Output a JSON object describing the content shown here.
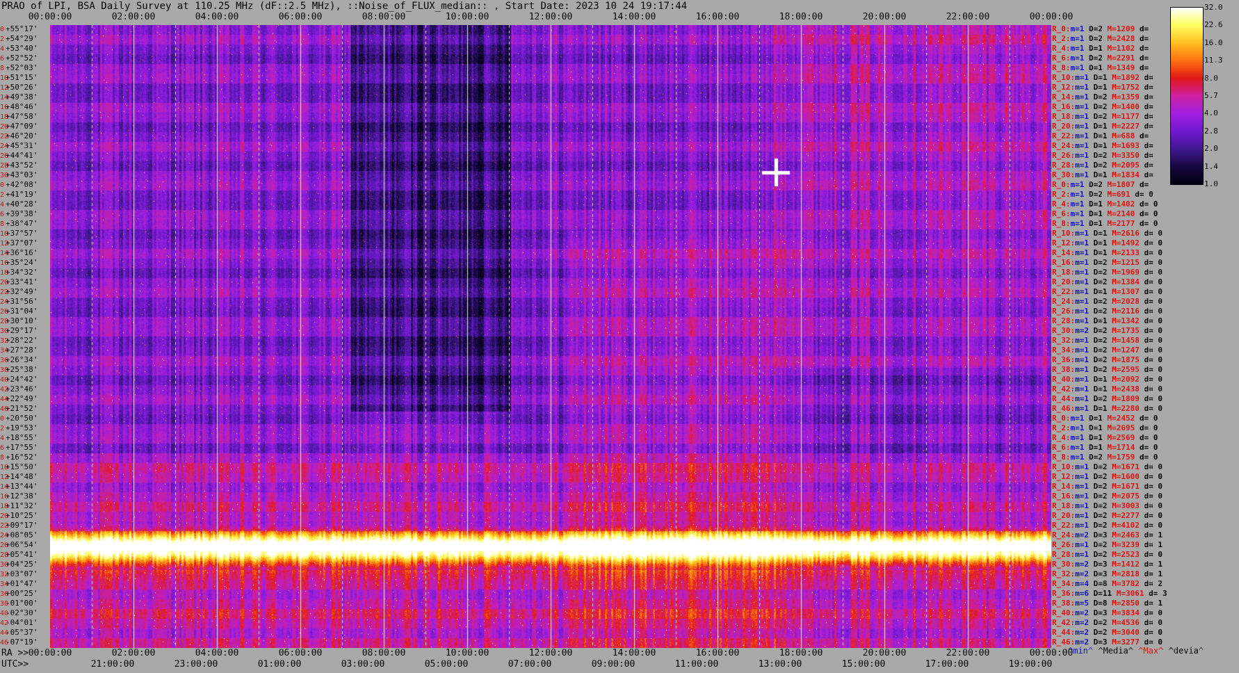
{
  "title": "PRAO of LPI, BSA Daily Survey at 110.25 MHz (dF::2.5 MHz), ::Noise_of_FLUX_median:: , Start Date: 2023 10 24 19:17:44",
  "chart_data": {
    "type": "heatmap",
    "title": "PRAO of LPI, BSA Daily Survey at 110.25 MHz (dF::2.5 MHz), ::Noise_of_FLUX_median:: , Start Date: 2023 10 24 19:17:44",
    "top_ticks": [
      "00:00:00",
      "02:00:00",
      "04:00:00",
      "06:00:00",
      "08:00:00",
      "10:00:00",
      "12:00:00",
      "14:00:00",
      "16:00:00",
      "18:00:00",
      "20:00:00",
      "22:00:00",
      "00:00:00"
    ],
    "bottom_ra_prefix": "RA >>",
    "bottom_ra_ticks": [
      "00:00:00",
      "02:00:00",
      "04:00:00",
      "06:00:00",
      "08:00:00",
      "10:00:00",
      "12:00:00",
      "14:00:00",
      "16:00:00",
      "18:00:00",
      "20:00:00",
      "22:00:00",
      "00:00:00"
    ],
    "bottom_utc_prefix": "UTC>>",
    "bottom_utc_ticks": [
      "21:00:00",
      "23:00:00",
      "01:00:00",
      "03:00:00",
      "05:00:00",
      "07:00:00",
      "09:00:00",
      "11:00:00",
      "13:00:00",
      "15:00:00",
      "17:00:00",
      "19:00:00"
    ],
    "colorbar_ticks": [
      "32.0",
      "22.6",
      "16.0",
      "11.3",
      "8.0",
      "5.7",
      "4.0",
      "2.8",
      "2.0",
      "1.4",
      "1.0"
    ],
    "colorbar_colors": [
      "#ffffff",
      "#ffff60",
      "#ffc020",
      "#ff7010",
      "#e01818",
      "#d020a0",
      "#a020e0",
      "#7018d0",
      "#401890",
      "#180840",
      "#000010"
    ],
    "rows": [
      {
        "i": "0",
        "dec": "+55°17'",
        "r": "R_0:",
        "m": "1",
        "D": "2",
        "M": "1209",
        "tail": "d="
      },
      {
        "i": "2",
        "dec": "+54°29'",
        "r": "R_2:",
        "m": "1",
        "D": "2",
        "M": "2428",
        "tail": "d="
      },
      {
        "i": "4",
        "dec": "+53°40'",
        "r": "R_4:",
        "m": "1",
        "D": "1",
        "M": "1102",
        "tail": "d="
      },
      {
        "i": "6",
        "dec": "+52°52'",
        "r": "R_6:",
        "m": "1",
        "D": "2",
        "M": "2291",
        "tail": "d="
      },
      {
        "i": "8",
        "dec": "+52°03'",
        "r": "R_8:",
        "m": "1",
        "D": "1",
        "M": "1349",
        "tail": "d="
      },
      {
        "i": "10",
        "dec": "+51°15'",
        "r": "R_10:",
        "m": "1",
        "D": "1",
        "M": "1892",
        "tail": "d="
      },
      {
        "i": "12",
        "dec": "+50°26'",
        "r": "R_12:",
        "m": "1",
        "D": "1",
        "M": "1752",
        "tail": "d="
      },
      {
        "i": "14",
        "dec": "+49°38'",
        "r": "R_14:",
        "m": "1",
        "D": "2",
        "M": "1359",
        "tail": "d="
      },
      {
        "i": "16",
        "dec": "+48°46'",
        "r": "R_16:",
        "m": "1",
        "D": "2",
        "M": "1400",
        "tail": "d="
      },
      {
        "i": "18",
        "dec": "+47°58'",
        "r": "R_18:",
        "m": "1",
        "D": "2",
        "M": "1177",
        "tail": "d="
      },
      {
        "i": "20",
        "dec": "+47°09'",
        "r": "R_20:",
        "m": "1",
        "D": "1",
        "M": "2227",
        "tail": "d="
      },
      {
        "i": "22",
        "dec": "+46°20'",
        "r": "R_22:",
        "m": "1",
        "D": "1",
        "M": "688",
        "tail": "d="
      },
      {
        "i": "24",
        "dec": "+45°31'",
        "r": "R_24:",
        "m": "1",
        "D": "1",
        "M": "1693",
        "tail": "d="
      },
      {
        "i": "26",
        "dec": "+44°41'",
        "r": "R_26:",
        "m": "1",
        "D": "2",
        "M": "3350",
        "tail": "d="
      },
      {
        "i": "28",
        "dec": "+43°52'",
        "r": "R_28:",
        "m": "1",
        "D": "2",
        "M": "2095",
        "tail": "d="
      },
      {
        "i": "30",
        "dec": "+43°03'",
        "r": "R_30:",
        "m": "1",
        "D": "1",
        "M": "1834",
        "tail": "d="
      },
      {
        "i": "0",
        "dec": "+42°08'",
        "r": "R_0:",
        "m": "1",
        "D": "2",
        "M": "1807",
        "tail": "d="
      },
      {
        "i": "2",
        "dec": "+41°19'",
        "r": "R_2:",
        "m": "1",
        "D": "2",
        "M": "691",
        "tail": "d= 0"
      },
      {
        "i": "4",
        "dec": "+40°28'",
        "r": "R_4:",
        "m": "1",
        "D": "1",
        "M": "1402",
        "tail": "d= 0"
      },
      {
        "i": "6",
        "dec": "+39°38'",
        "r": "R_6:",
        "m": "1",
        "D": "1",
        "M": "2140",
        "tail": "d= 0"
      },
      {
        "i": "8",
        "dec": "+38°47'",
        "r": "R_8:",
        "m": "1",
        "D": "1",
        "M": "2177",
        "tail": "d= 0"
      },
      {
        "i": "10",
        "dec": "+37°57'",
        "r": "R_10:",
        "m": "1",
        "D": "1",
        "M": "2616",
        "tail": "d= 0"
      },
      {
        "i": "12",
        "dec": "+37°07'",
        "r": "R_12:",
        "m": "1",
        "D": "1",
        "M": "1492",
        "tail": "d= 0"
      },
      {
        "i": "14",
        "dec": "+36°16'",
        "r": "R_14:",
        "m": "1",
        "D": "1",
        "M": "2133",
        "tail": "d= 0"
      },
      {
        "i": "16",
        "dec": "+35°24'",
        "r": "R_16:",
        "m": "1",
        "D": "2",
        "M": "1215",
        "tail": "d= 0"
      },
      {
        "i": "18",
        "dec": "+34°32'",
        "r": "R_18:",
        "m": "1",
        "D": "2",
        "M": "1969",
        "tail": "d= 0"
      },
      {
        "i": "20",
        "dec": "+33°41'",
        "r": "R_20:",
        "m": "1",
        "D": "2",
        "M": "1384",
        "tail": "d= 0"
      },
      {
        "i": "22",
        "dec": "+32°49'",
        "r": "R_22:",
        "m": "1",
        "D": "1",
        "M": "1307",
        "tail": "d= 0"
      },
      {
        "i": "24",
        "dec": "+31°56'",
        "r": "R_24:",
        "m": "1",
        "D": "2",
        "M": "2028",
        "tail": "d= 0"
      },
      {
        "i": "26",
        "dec": "+31°04'",
        "r": "R_26:",
        "m": "1",
        "D": "2",
        "M": "2116",
        "tail": "d= 0"
      },
      {
        "i": "28",
        "dec": "+30°10'",
        "r": "R_28:",
        "m": "1",
        "D": "1",
        "M": "1342",
        "tail": "d= 0"
      },
      {
        "i": "30",
        "dec": "+29°17'",
        "r": "R_30:",
        "m": "2",
        "D": "2",
        "M": "1735",
        "tail": "d= 0"
      },
      {
        "i": "32",
        "dec": "+28°22'",
        "r": "R_32:",
        "m": "1",
        "D": "2",
        "M": "1458",
        "tail": "d= 0"
      },
      {
        "i": "34",
        "dec": "+27°28'",
        "r": "R_34:",
        "m": "1",
        "D": "2",
        "M": "1247",
        "tail": "d= 0"
      },
      {
        "i": "36",
        "dec": "+26°34'",
        "r": "R_36:",
        "m": "1",
        "D": "2",
        "M": "1875",
        "tail": "d= 0"
      },
      {
        "i": "38",
        "dec": "+25°38'",
        "r": "R_38:",
        "m": "1",
        "D": "2",
        "M": "2595",
        "tail": "d= 0"
      },
      {
        "i": "40",
        "dec": "+24°42'",
        "r": "R_40:",
        "m": "1",
        "D": "1",
        "M": "2092",
        "tail": "d= 0"
      },
      {
        "i": "42",
        "dec": "+23°46'",
        "r": "R_42:",
        "m": "1",
        "D": "1",
        "M": "2438",
        "tail": "d= 0"
      },
      {
        "i": "44",
        "dec": "+22°49'",
        "r": "R_44:",
        "m": "1",
        "D": "2",
        "M": "1809",
        "tail": "d= 0"
      },
      {
        "i": "46",
        "dec": "+21°52'",
        "r": "R_46:",
        "m": "1",
        "D": "1",
        "M": "2280",
        "tail": "d= 0"
      },
      {
        "i": "0",
        "dec": "+20°50'",
        "r": "R_0:",
        "m": "1",
        "D": "1",
        "M": "2452",
        "tail": "d= 0"
      },
      {
        "i": "2",
        "dec": "+19°53'",
        "r": "R_2:",
        "m": "1",
        "D": "1",
        "M": "2695",
        "tail": "d= 0"
      },
      {
        "i": "4",
        "dec": "+18°55'",
        "r": "R_4:",
        "m": "1",
        "D": "1",
        "M": "2569",
        "tail": "d= 0"
      },
      {
        "i": "6",
        "dec": "+17°55'",
        "r": "R_6:",
        "m": "1",
        "D": "1",
        "M": "1714",
        "tail": "d= 0"
      },
      {
        "i": "8",
        "dec": "+16°52'",
        "r": "R_8:",
        "m": "1",
        "D": "2",
        "M": "1759",
        "tail": "d= 0"
      },
      {
        "i": "10",
        "dec": "+15°50'",
        "r": "R_10:",
        "m": "1",
        "D": "2",
        "M": "1671",
        "tail": "d= 0"
      },
      {
        "i": "12",
        "dec": "+14°48'",
        "r": "R_12:",
        "m": "1",
        "D": "2",
        "M": "1600",
        "tail": "d= 0"
      },
      {
        "i": "14",
        "dec": "+13°44'",
        "r": "R_14:",
        "m": "1",
        "D": "2",
        "M": "1671",
        "tail": "d= 0"
      },
      {
        "i": "16",
        "dec": "+12°38'",
        "r": "R_16:",
        "m": "1",
        "D": "2",
        "M": "2075",
        "tail": "d= 0"
      },
      {
        "i": "18",
        "dec": "+11°32'",
        "r": "R_18:",
        "m": "1",
        "D": "2",
        "M": "3003",
        "tail": "d= 0"
      },
      {
        "i": "20",
        "dec": "+10°25'",
        "r": "R_20:",
        "m": "1",
        "D": "2",
        "M": "2277",
        "tail": "d= 0"
      },
      {
        "i": "22",
        "dec": "+09°17'",
        "r": "R_22:",
        "m": "1",
        "D": "2",
        "M": "4102",
        "tail": "d= 0"
      },
      {
        "i": "24",
        "dec": "+08°05'",
        "r": "R_24:",
        "m": "2",
        "D": "3",
        "M": "2463",
        "tail": "d= 1"
      },
      {
        "i": "26",
        "dec": "+06°54'",
        "r": "R_26:",
        "m": "1",
        "D": "2",
        "M": "3239",
        "tail": "d= 1"
      },
      {
        "i": "28",
        "dec": "+05°41'",
        "r": "R_28:",
        "m": "1",
        "D": "2",
        "M": "2523",
        "tail": "d= 0"
      },
      {
        "i": "30",
        "dec": "+04°25'",
        "r": "R_30:",
        "m": "2",
        "D": "3",
        "M": "1412",
        "tail": "d= 1"
      },
      {
        "i": "32",
        "dec": "+03°07'",
        "r": "R_32:",
        "m": "2",
        "D": "3",
        "M": "2818",
        "tail": "d= 1"
      },
      {
        "i": "34",
        "dec": "+01°47'",
        "r": "R_34:",
        "m": "4",
        "D": "8",
        "M": "3782",
        "tail": "d= 2"
      },
      {
        "i": "36",
        "dec": "+00°25'",
        "r": "R_36:",
        "m": "6",
        "D": "11",
        "M": "3061",
        "tail": "d= 3"
      },
      {
        "i": "38",
        "dec": "-01°00'",
        "r": "R_38:",
        "m": "5",
        "D": "8",
        "M": "2850",
        "tail": "d= 1"
      },
      {
        "i": "40",
        "dec": "-02°30'",
        "r": "R_40:",
        "m": "2",
        "D": "3",
        "M": "3834",
        "tail": "d= 0"
      },
      {
        "i": "42",
        "dec": "-04°01'",
        "r": "R_42:",
        "m": "2",
        "D": "2",
        "M": "4536",
        "tail": "d= 0"
      },
      {
        "i": "44",
        "dec": "-05°37'",
        "r": "R_44:",
        "m": "2",
        "D": "2",
        "M": "3040",
        "tail": "d= 0"
      },
      {
        "i": "46",
        "dec": "-07°19'",
        "r": "R_46:",
        "m": "2",
        "D": "3",
        "M": "3277",
        "tail": "d= 0"
      }
    ],
    "legend_foot": {
      "min": "^min^",
      "media": "^Media^",
      "max": "^Max^",
      "devia": "^devia^"
    }
  }
}
